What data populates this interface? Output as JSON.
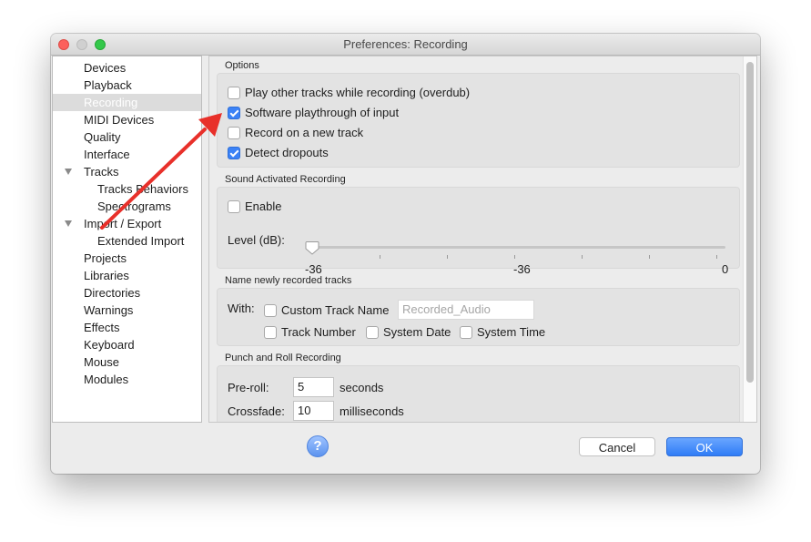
{
  "window": {
    "title": "Preferences: Recording"
  },
  "sidebar": {
    "items": [
      {
        "label": "Devices"
      },
      {
        "label": "Playback"
      },
      {
        "label": "Recording",
        "selected": true
      },
      {
        "label": "MIDI Devices"
      },
      {
        "label": "Quality"
      },
      {
        "label": "Interface"
      },
      {
        "label": "Tracks",
        "expandable": true
      },
      {
        "label": "Tracks Behaviors",
        "indent": 1
      },
      {
        "label": "Spectrograms",
        "indent": 1
      },
      {
        "label": "Import / Export",
        "expandable": true
      },
      {
        "label": "Extended Import",
        "indent": 1
      },
      {
        "label": "Projects"
      },
      {
        "label": "Libraries"
      },
      {
        "label": "Directories"
      },
      {
        "label": "Warnings"
      },
      {
        "label": "Effects"
      },
      {
        "label": "Keyboard"
      },
      {
        "label": "Mouse"
      },
      {
        "label": "Modules"
      }
    ]
  },
  "options": {
    "heading": "Options",
    "overdub": {
      "label": "Play other tracks while recording (overdub)",
      "checked": false
    },
    "playthrough": {
      "label": "Software playthrough of input",
      "checked": true
    },
    "new_track": {
      "label": "Record on a new track",
      "checked": false
    },
    "dropouts": {
      "label": "Detect dropouts",
      "checked": true
    }
  },
  "sound_activated": {
    "heading": "Sound Activated Recording",
    "enable": {
      "label": "Enable",
      "checked": false
    },
    "level_label": "Level (dB):",
    "level_value": -36,
    "min_label": "-36",
    "mid_label": "-36",
    "max_label": "0"
  },
  "naming": {
    "heading": "Name newly recorded tracks",
    "with_label": "With:",
    "custom_name": {
      "label": "Custom Track Name",
      "checked": false
    },
    "custom_name_value": "Recorded_Audio",
    "track_number": {
      "label": "Track Number",
      "checked": false
    },
    "system_date": {
      "label": "System Date",
      "checked": false
    },
    "system_time": {
      "label": "System Time",
      "checked": false
    }
  },
  "punch": {
    "heading": "Punch and Roll Recording",
    "preroll_label": "Pre-roll:",
    "preroll_value": "5",
    "preroll_unit": "seconds",
    "crossfade_label": "Crossfade:",
    "crossfade_value": "10",
    "crossfade_unit": "milliseconds"
  },
  "buttons": {
    "help": "?",
    "cancel": "Cancel",
    "ok": "OK"
  },
  "colors": {
    "accent": "#3b82f6",
    "annotation_arrow": "#e8302a"
  },
  "annotation": {
    "icon": "red-arrow"
  }
}
